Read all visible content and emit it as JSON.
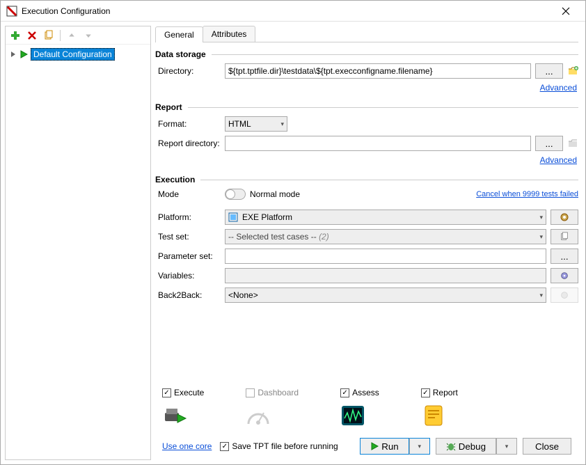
{
  "window": {
    "title": "Execution Configuration"
  },
  "sidebar": {
    "items": [
      {
        "label": "Default Configuration",
        "selected": true
      }
    ]
  },
  "tabs": [
    {
      "label": "General",
      "active": true
    },
    {
      "label": "Attributes",
      "active": false
    }
  ],
  "data_storage": {
    "title": "Data storage",
    "directory_label": "Directory:",
    "directory_value": "${tpt.tptfile.dir}\\testdata\\${tpt.execconfigname.filename}",
    "advanced": "Advanced"
  },
  "report": {
    "title": "Report",
    "format_label": "Format:",
    "format_value": "HTML",
    "dir_label": "Report directory:",
    "dir_value": "",
    "advanced": "Advanced"
  },
  "execution": {
    "title": "Execution",
    "mode_label": "Mode",
    "mode_value": "Normal mode",
    "cancel_link": "Cancel when 9999 tests failed",
    "platform_label": "Platform:",
    "platform_value": "EXE Platform",
    "testset_label": "Test set:",
    "testset_value": "-- Selected test cases --",
    "testset_count": "(2)",
    "paramset_label": "Parameter set:",
    "paramset_value": "",
    "variables_label": "Variables:",
    "variables_value": "",
    "b2b_label": "Back2Back:",
    "b2b_value": "<None>"
  },
  "options": {
    "execute": "Execute",
    "dashboard": "Dashboard",
    "assess": "Assess",
    "report": "Report"
  },
  "footer": {
    "one_core": "Use one core",
    "save_tpt": "Save TPT file before running",
    "run": "Run",
    "debug": "Debug",
    "close": "Close"
  }
}
